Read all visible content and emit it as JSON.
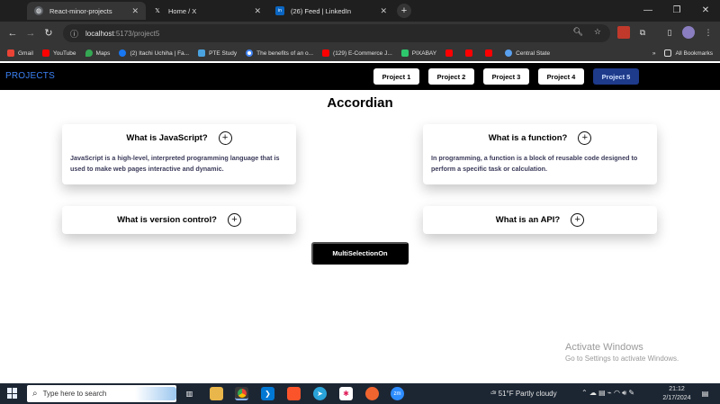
{
  "browser": {
    "tabs": [
      {
        "title": "React-minor-projects",
        "icon": "globe-icon",
        "active": true
      },
      {
        "title": "Home / X",
        "icon": "x-logo-icon",
        "active": false
      },
      {
        "title": "(26) Feed | LinkedIn",
        "icon": "linkedin-icon",
        "active": false
      }
    ],
    "url_host": "localhost",
    "url_path": ":5173/project5",
    "bookmarks": [
      {
        "label": "Gmail",
        "icon": "gmail-icon",
        "color": "#ea4335"
      },
      {
        "label": "YouTube",
        "icon": "youtube-icon",
        "color": "#ff0000"
      },
      {
        "label": "Maps",
        "icon": "maps-icon",
        "color": "#34a853"
      },
      {
        "label": "(2) Itachi Uchiha | Fa...",
        "icon": "facebook-icon",
        "color": "#1877f2"
      },
      {
        "label": "PTE Study",
        "icon": "pte-icon",
        "color": "#4aa3df"
      },
      {
        "label": "The benefits of an o...",
        "icon": "google-icon",
        "color": "#4285f4"
      },
      {
        "label": "(129) E-Commerce J...",
        "icon": "youtube-icon",
        "color": "#ff0000"
      },
      {
        "label": "PIXABAY",
        "icon": "pixabay-icon",
        "color": "#2ec66d"
      },
      {
        "label": "",
        "icon": "youtube-icon",
        "color": "#ff0000"
      },
      {
        "label": "",
        "icon": "youtube-icon",
        "color": "#ff0000"
      },
      {
        "label": "",
        "icon": "youtube-icon",
        "color": "#ff0000"
      },
      {
        "label": "Central State",
        "icon": "globe-icon",
        "color": "#5aa0f0"
      }
    ],
    "all_bookmarks": "All Bookmarks"
  },
  "app": {
    "brand": "PROJECTS",
    "nav": [
      {
        "label": "Project 1",
        "active": false
      },
      {
        "label": "Project 2",
        "active": false
      },
      {
        "label": "Project 3",
        "active": false
      },
      {
        "label": "Project 4",
        "active": false
      },
      {
        "label": "Project 5",
        "active": true
      }
    ],
    "title": "Accordian",
    "items": [
      {
        "question": "What is JavaScript?",
        "answer": "JavaScript is a high-level, interpreted programming language that is used to make web pages interactive and dynamic.",
        "open": true
      },
      {
        "question": "What is a function?",
        "answer": "In programming, a function is a block of reusable code designed to perform a specific task or calculation.",
        "open": true
      },
      {
        "question": "What is version control?",
        "answer": "",
        "open": false
      },
      {
        "question": "What is an API?",
        "answer": "",
        "open": false
      }
    ],
    "toggle_label": "MultiSelectionOn"
  },
  "watermark": {
    "line1": "Activate Windows",
    "line2": "Go to Settings to activate Windows."
  },
  "taskbar": {
    "search_placeholder": "Type here to search",
    "weather": "51°F  Partly cloudy",
    "time": "21:12",
    "date": "2/17/2024"
  },
  "colors": {
    "brand": "#3b82f6",
    "active_nav": "#1e3a8a"
  }
}
